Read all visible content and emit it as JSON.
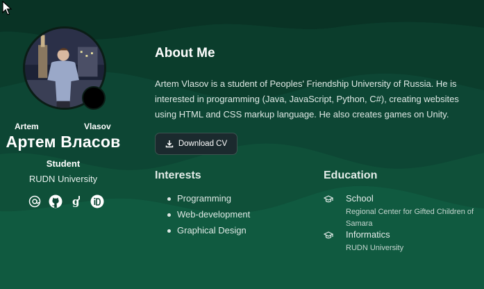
{
  "profile": {
    "first_name_latin": "Artem",
    "last_name_latin": "Vlasov",
    "name_cyrillic": "Артем Власов",
    "role": "Student",
    "university": "RUDN University",
    "socials": [
      "at-icon",
      "github-icon",
      "google-scholar-icon",
      "orcid-icon"
    ]
  },
  "about": {
    "title": "About Me",
    "text": "Artem Vlasov is a student of Peoples' Friendship University of Russia. He is interested in programming (Java, JavaScript, Python, C#), creating websites using HTML and CSS markup language. He also creates games on Unity.",
    "cv_button": "Download CV"
  },
  "interests": {
    "title": "Interests",
    "items": [
      "Programming",
      "Web-development",
      "Graphical Design"
    ]
  },
  "education": {
    "title": "Education",
    "items": [
      {
        "title": "School",
        "subtitle": "Regional Center for Gifted Children of Samara"
      },
      {
        "title": "Informatics",
        "subtitle": "RUDN University"
      }
    ]
  },
  "colors": {
    "background": "#0d4a36",
    "wave_dark": "#0a3a2a",
    "wave_light": "#115a41",
    "button": "#1b2a2e"
  }
}
